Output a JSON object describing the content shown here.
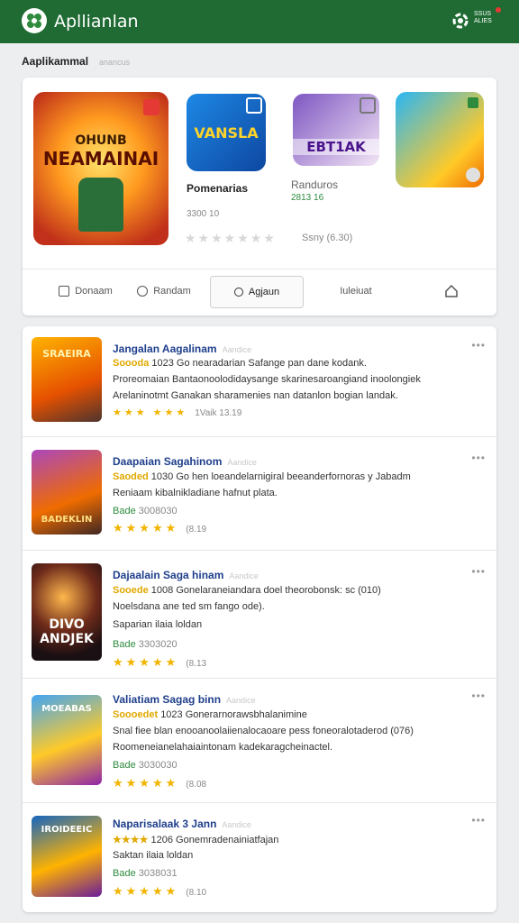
{
  "header": {
    "title": "Apllianlan",
    "badge": "SSUS ALIES"
  },
  "section": {
    "title": "Aaplikammal",
    "subtitle": "anancus"
  },
  "featured": [
    {
      "thumb_text": "NEAMAINAI",
      "thumb_top": "OHUNB"
    },
    {
      "thumb_text": "VANSLA",
      "name": "Pomenarias",
      "meta1": "",
      "meta2": "3300 10"
    },
    {
      "thumb_text": "EBT1AK",
      "name": "Randuros",
      "meta1": "2813 16",
      "meta2": ""
    },
    {
      "thumb_text": ""
    }
  ],
  "featured_rating": {
    "stars": "★★★★★★★",
    "label": "Ssny   (6.30)"
  },
  "tabs": [
    {
      "label": "Donaam",
      "icon": "grid-icon"
    },
    {
      "label": "Randam",
      "icon": "search-icon"
    },
    {
      "label": "Agjaun",
      "icon": "circle-icon"
    },
    {
      "label": "Iuleiuat",
      "icon": ""
    },
    {
      "label": "",
      "icon": "home-icon"
    }
  ],
  "items": [
    {
      "title": "Jangalan  Aagalinam",
      "title_sub": "Aandice",
      "line1_gold": "Soooda",
      "line1": "1023 Go nearadarian Safange pan dane kodank.",
      "line2": "Proreomaian Bantaonoolodidaysange skarinesaroangiand inoolongiek",
      "line3": "Arelaninotmt Ganakan sharamenies nan datanlon bogian landak.",
      "stars": "★★★  ★★★",
      "stats": "1Vaik   13.19",
      "thumb_text": "SRAEIRA"
    },
    {
      "title": "Daapaian  Sagahinom",
      "title_sub": "Aandice",
      "line1_gold": "Saoded",
      "line1": "1030 Go hen loeandelarnigiral beeanderfornoras y Jabadm",
      "line2": "Reniaam kibalnikladiane hafnut plata.",
      "badge": "Bade",
      "stats": "3008030",
      "stars": "★★★★★",
      "rating": "(8.19",
      "thumb_text": "BADEKLIN"
    },
    {
      "title": "Dajaalain  Saga hinam",
      "title_sub": "Aandice",
      "line1_gold": "Sooede",
      "line1": "1008 Gonelaraneiandara doel theorobonsk: sc (010)",
      "line2": "Noelsdana ane ted sm fango ode).",
      "line3": "Saparian ilaia loldan",
      "badge": "Bade",
      "stats": "3303020",
      "stars": "★★★★★",
      "rating": "(8.13",
      "thumb_text": "DIVO ANDJEK"
    },
    {
      "title": "Valiatiam  Sagag binn",
      "title_sub": "Aandice",
      "line1_gold": "Soooedet",
      "line1": "1023 Gonerarnorawsbhalanimine",
      "line2": "Snal fiee blan enooanoolaiienalocaoare pess foneoralotaderod (076)",
      "line3": "Roomeneianelahaiaintonam kadekaragcheinactel.",
      "badge": "Bade",
      "stats": "3030030",
      "stars": "★★★★★",
      "rating": "(8.08",
      "thumb_text": "MOEABAS"
    },
    {
      "title": "Naparisalaak 3 Jann",
      "title_sub": "Aandice",
      "line1_gold": "★★★★",
      "line1": "1206 Gonemradenainiatfajan",
      "line2": "Saktan ilaia loldan",
      "badge": "Bade",
      "stats": "3038031",
      "stars": "★★★★★",
      "rating": "(8.10",
      "thumb_text": "IROIDEEIC"
    }
  ]
}
